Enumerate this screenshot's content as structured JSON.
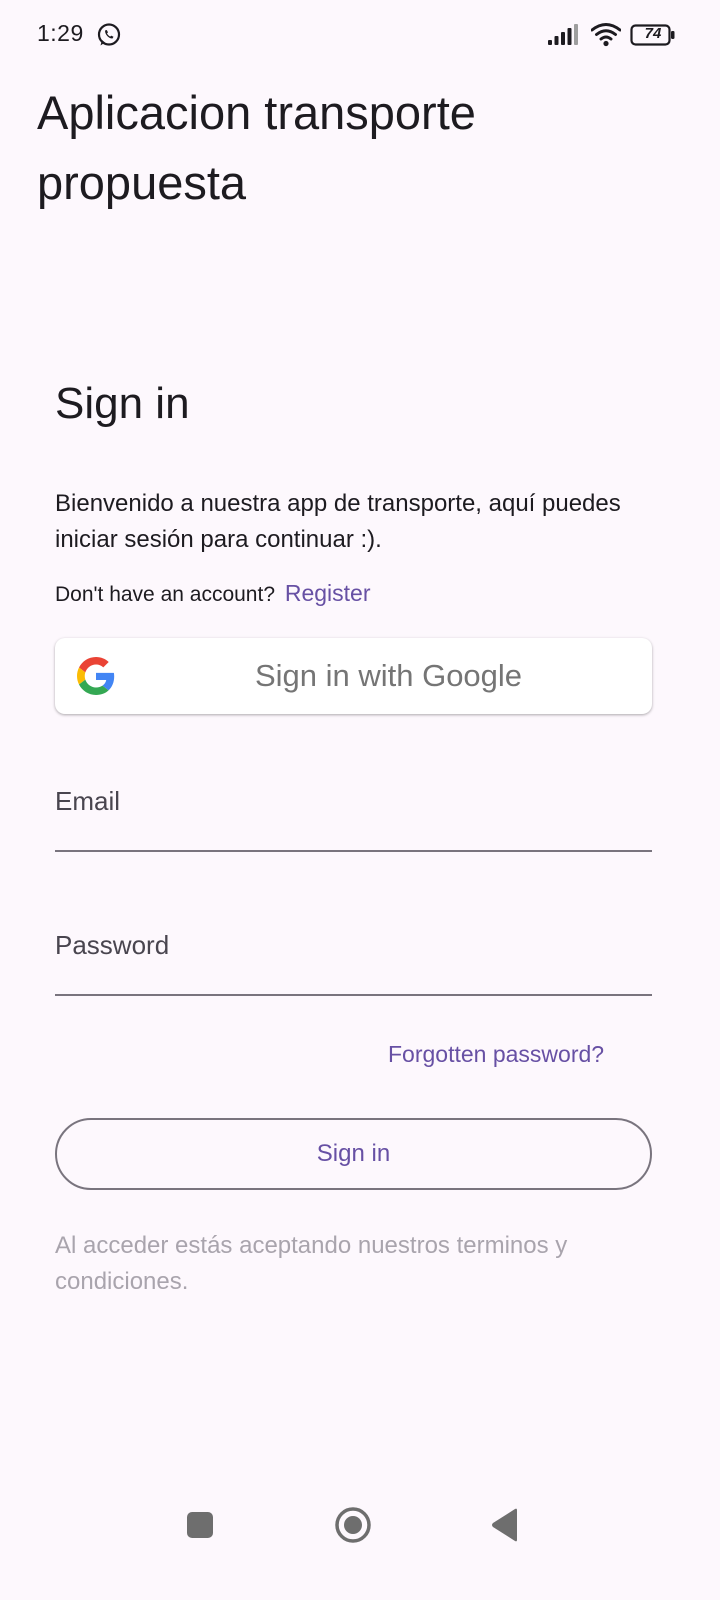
{
  "status_bar": {
    "time": "1:29",
    "battery_level": "74",
    "icons": [
      "whatsapp-icon",
      "signal-icon",
      "wifi-icon",
      "battery-icon"
    ]
  },
  "app": {
    "title": "Aplicacion transporte propuesta"
  },
  "signin": {
    "heading": "Sign in",
    "welcome": "Bienvenido a nuestra app de transporte, aquí puedes iniciar sesión para continuar :).",
    "no_account_prompt": "Don't have an account?",
    "register_label": "Register",
    "google_button_label": "Sign in with Google",
    "email_placeholder": "Email",
    "password_placeholder": "Password",
    "forgot_password_label": "Forgotten password?",
    "signin_button_label": "Sign in",
    "terms_text": "Al acceder estás aceptando nuestros terminos y condiciones."
  },
  "colors": {
    "background": "#fdf8fd",
    "accent": "#6750a4",
    "text": "#1d1b20",
    "muted_text": "#a9a4ad",
    "outline": "#79747e"
  },
  "nav_bar": {
    "icons": [
      "recents-icon",
      "home-icon",
      "back-icon"
    ]
  }
}
